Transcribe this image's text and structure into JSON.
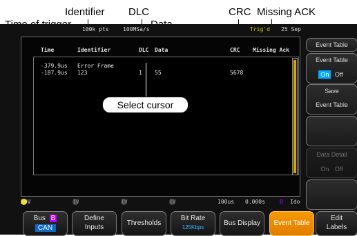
{
  "callouts": {
    "time_of_trigger": "Time of trigger",
    "identifier": "Identifier",
    "dlc": "DLC",
    "data": "Data",
    "crc": "CRC",
    "missing_ack": "Missing ACK",
    "select_cursor": "Select cursor"
  },
  "scope": {
    "top_left": "100k pts",
    "top_mid": "100MSa/s",
    "trig_label": "Trig'd",
    "date": "25 Sep"
  },
  "table": {
    "headers": [
      "Time",
      "Identifier",
      "DLC",
      "Data",
      "CRC",
      "Missing Ack"
    ],
    "rows": [
      {
        "time": "-379.9us",
        "identifier": "Error Frame",
        "dlc": "",
        "data": "",
        "crc": ""
      },
      {
        "time": "-187.9us",
        "identifier": "123",
        "dlc": "1",
        "data": "55",
        "crc": "5678"
      }
    ]
  },
  "right_menu": {
    "event_table": "Event Table",
    "event_table2": "Event Table",
    "on": "On",
    "off": "Off",
    "save_line1": "Save",
    "save_line2": "Event Table",
    "data_detail": "Data Detail",
    "on2": "On",
    "off2": "Off"
  },
  "status": {
    "ch1": "20V",
    "ch2": "1V",
    "ch3": "1V",
    "ch4": "1V",
    "timebase": "100us",
    "offset": "0.000s",
    "bus": "B",
    "ido": "Ido"
  },
  "bottom_menu": [
    {
      "label": "Bus",
      "label2": "CAN",
      "badge": "B"
    },
    {
      "label": "Define",
      "label2": "Inputs"
    },
    {
      "label": "Thresholds"
    },
    {
      "label": "Bit Rate",
      "label2": "125Kbps"
    },
    {
      "label": "Bus Display"
    },
    {
      "label": "Event Table"
    },
    {
      "label": "Edit",
      "label2": "Labels"
    }
  ]
}
